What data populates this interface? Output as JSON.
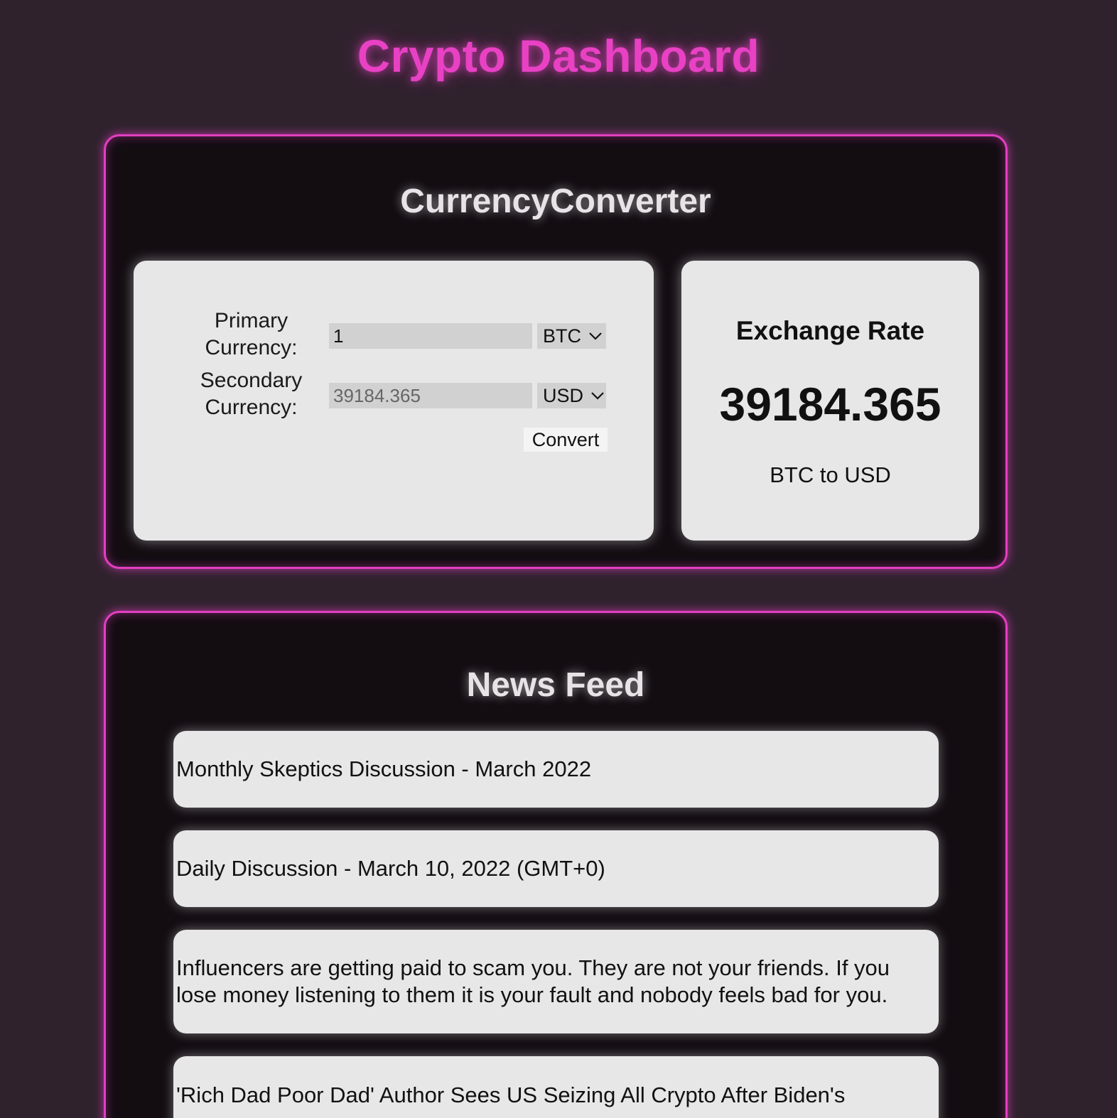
{
  "header": {
    "title": "Crypto Dashboard"
  },
  "converter": {
    "title": "CurrencyConverter",
    "primary_label": "Primary Currency:",
    "secondary_label": "Secondary Currency:",
    "primary_amount": "1",
    "secondary_amount_placeholder": "39184.365",
    "primary_currency": "BTC",
    "secondary_currency": "USD",
    "convert_label": "Convert"
  },
  "exchange_rate": {
    "title": "Exchange Rate",
    "value": "39184.365",
    "pair": "BTC to USD"
  },
  "news": {
    "title": "News Feed",
    "items": [
      {
        "title": "Monthly Skeptics Discussion - March 2022"
      },
      {
        "title": "Daily Discussion - March 10, 2022 (GMT+0)"
      },
      {
        "title": "Influencers are getting paid to scam you. They are not your friends. If you lose money listening to them it is your fault and nobody feels bad for you."
      },
      {
        "title": "'Rich Dad Poor Dad' Author Sees US Seizing All Crypto After Biden's"
      }
    ]
  },
  "colors": {
    "background": "#2f222d",
    "accent": "#e841c4",
    "panel": "#130d12",
    "card": "#e7e7e7"
  },
  "icons": {
    "select_chevron": "chevron-down-icon"
  }
}
